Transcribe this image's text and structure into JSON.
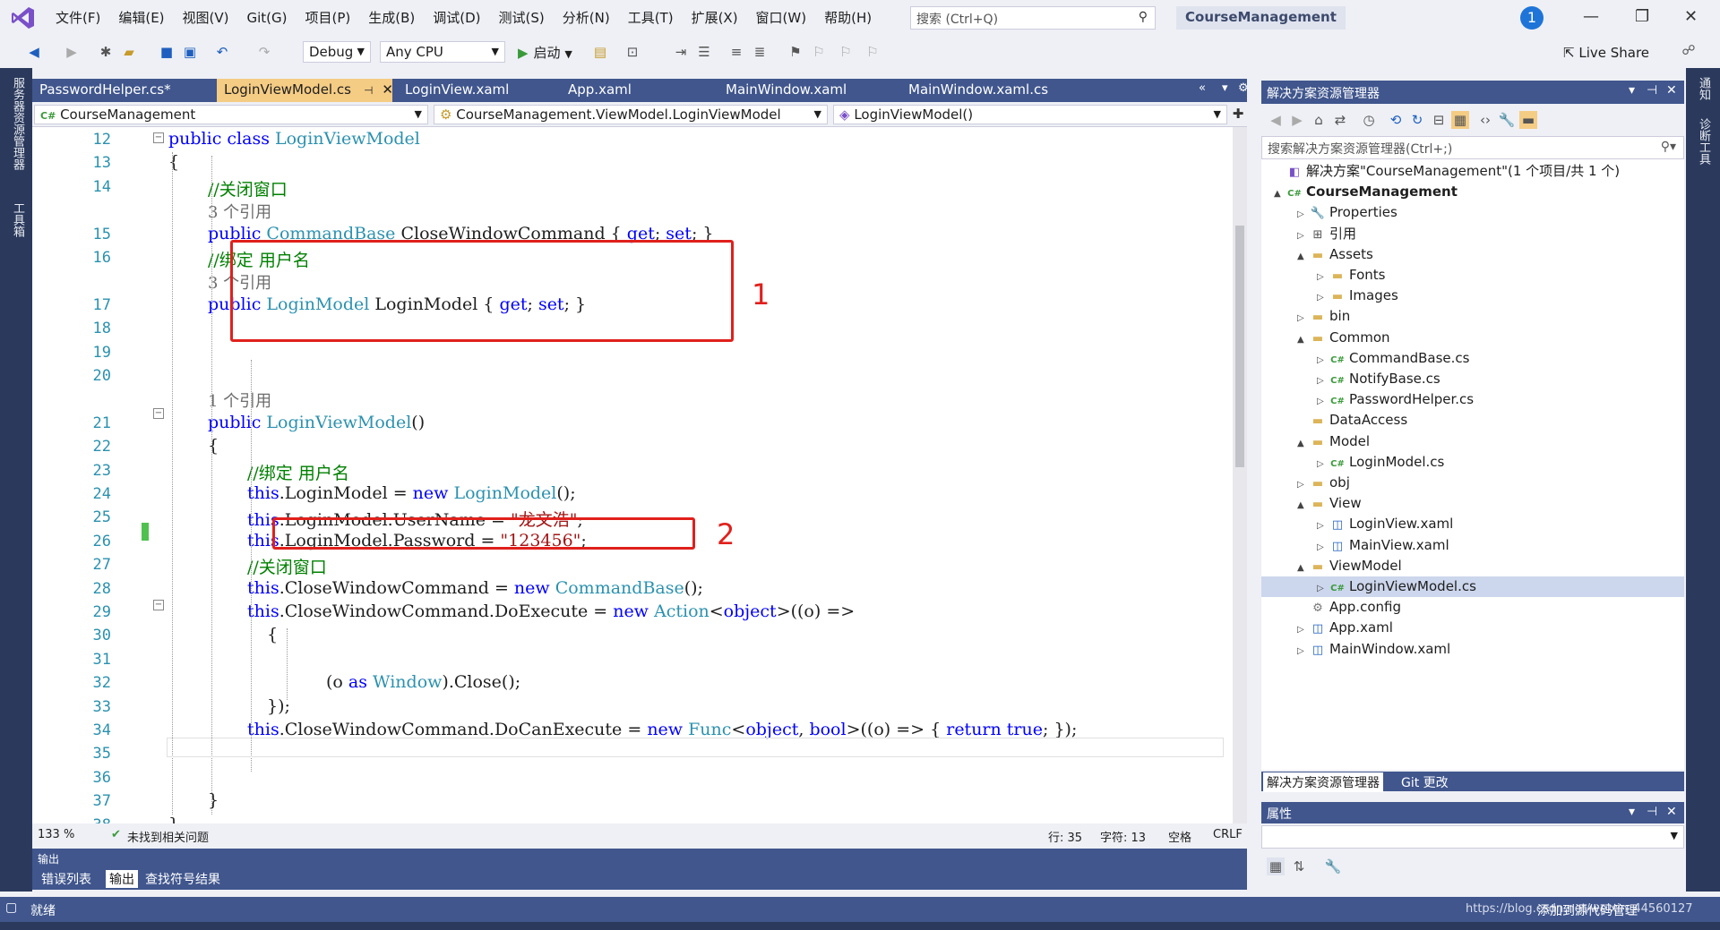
{
  "menu": [
    "文件(F)",
    "编辑(E)",
    "视图(V)",
    "Git(G)",
    "项目(P)",
    "生成(B)",
    "调试(D)",
    "测试(S)",
    "分析(N)",
    "工具(T)",
    "扩展(X)",
    "窗口(W)",
    "帮助(H)"
  ],
  "search": {
    "placeholder": "搜索 (Ctrl+Q)"
  },
  "solution_name": "CourseManagement",
  "notification_count": "1",
  "toolbar": {
    "config": "Debug",
    "platform": "Any CPU",
    "start": "启动",
    "live_share": "Live Share"
  },
  "tabs": [
    {
      "label": "PasswordHelper.cs*"
    },
    {
      "label": "LoginViewModel.cs"
    },
    {
      "label": "LoginView.xaml"
    },
    {
      "label": "App.xaml"
    },
    {
      "label": "MainWindow.xaml"
    },
    {
      "label": "MainWindow.xaml.cs"
    }
  ],
  "nav": {
    "project": "CourseManagement",
    "class": "CourseManagement.ViewModel.LoginViewModel",
    "member": "LoginViewModel()"
  },
  "left_strip": {
    "server": "服务器资源管理器",
    "toolbox": "工具箱"
  },
  "code": {
    "lines": [
      {
        "n": "12",
        "parts": [
          [
            "kw",
            "public class "
          ],
          [
            "ty",
            "LoginViewModel"
          ]
        ]
      },
      {
        "n": "13",
        "parts": [
          [
            "",
            "{"
          ]
        ]
      },
      {
        "n": "14",
        "parts": [
          [
            "cm",
            "//关闭窗口"
          ]
        ]
      },
      {
        "ref": "3 个引用"
      },
      {
        "n": "15",
        "parts": [
          [
            "kw",
            "public "
          ],
          [
            "ty",
            "CommandBase "
          ],
          [
            "",
            "CloseWindowCommand { "
          ],
          [
            "kw",
            "get"
          ],
          [
            "",
            "; "
          ],
          [
            "kw",
            "set"
          ],
          [
            "",
            "; }"
          ]
        ]
      },
      {
        "n": "16",
        "parts": [
          [
            "cm",
            "//绑定 用户名"
          ]
        ]
      },
      {
        "ref": "3 个引用"
      },
      {
        "n": "17",
        "parts": [
          [
            "kw",
            "public "
          ],
          [
            "ty",
            "LoginModel "
          ],
          [
            "",
            "LoginModel { "
          ],
          [
            "kw",
            "get"
          ],
          [
            "",
            "; "
          ],
          [
            "kw",
            "set"
          ],
          [
            "",
            "; }"
          ]
        ]
      },
      {
        "n": "18",
        "parts": []
      },
      {
        "n": "19",
        "parts": []
      },
      {
        "n": "20",
        "parts": []
      },
      {
        "ref": "1 个引用"
      },
      {
        "n": "21",
        "parts": [
          [
            "kw",
            "public "
          ],
          [
            "ty",
            "LoginViewModel"
          ],
          [
            "",
            "()"
          ]
        ]
      },
      {
        "n": "22",
        "parts": [
          [
            "",
            "{"
          ]
        ]
      },
      {
        "n": "23",
        "parts": [
          [
            "cm",
            "//绑定 用户名"
          ]
        ]
      },
      {
        "n": "24",
        "parts": [
          [
            "kw",
            "this"
          ],
          [
            "",
            ".LoginModel = "
          ],
          [
            "kw",
            "new "
          ],
          [
            "ty",
            "LoginModel"
          ],
          [
            "",
            "();"
          ]
        ]
      },
      {
        "n": "25",
        "parts": [
          [
            "kw",
            "this"
          ],
          [
            "",
            ".LoginModel.UserName = "
          ],
          [
            "st",
            "\"龙文浩\""
          ],
          [
            "",
            ";"
          ]
        ]
      },
      {
        "n": "26",
        "parts": [
          [
            "kw",
            "this"
          ],
          [
            "",
            ".LoginModel.Password = "
          ],
          [
            "st",
            "\"123456\""
          ],
          [
            "",
            ";"
          ]
        ]
      },
      {
        "n": "27",
        "parts": [
          [
            "cm",
            "//关闭窗口"
          ]
        ]
      },
      {
        "n": "28",
        "parts": [
          [
            "kw",
            "this"
          ],
          [
            "",
            ".CloseWindowCommand = "
          ],
          [
            "kw",
            "new "
          ],
          [
            "ty",
            "CommandBase"
          ],
          [
            "",
            "();"
          ]
        ]
      },
      {
        "n": "29",
        "parts": [
          [
            "kw",
            "this"
          ],
          [
            "",
            ".CloseWindowCommand.DoExecute = "
          ],
          [
            "kw",
            "new "
          ],
          [
            "ty",
            "Action"
          ],
          [
            "",
            "<"
          ],
          [
            "kw",
            "object"
          ],
          [
            "",
            ">((o) =>"
          ]
        ]
      },
      {
        "n": "30",
        "parts": [
          [
            "",
            "{"
          ]
        ]
      },
      {
        "n": "31",
        "parts": []
      },
      {
        "n": "32",
        "parts": [
          [
            "",
            "(o "
          ],
          [
            "kw",
            "as "
          ],
          [
            "ty",
            "Window"
          ],
          [
            "",
            ").Close();"
          ]
        ]
      },
      {
        "n": "33",
        "parts": [
          [
            "",
            "});"
          ]
        ]
      },
      {
        "n": "34",
        "parts": [
          [
            "kw",
            "this"
          ],
          [
            "",
            ".CloseWindowCommand.DoCanExecute = "
          ],
          [
            "kw",
            "new "
          ],
          [
            "ty",
            "Func"
          ],
          [
            "",
            "<"
          ],
          [
            "kw",
            "object"
          ],
          [
            "",
            ", "
          ],
          [
            "kw",
            "bool"
          ],
          [
            "",
            ">((o) => { "
          ],
          [
            "kw",
            "return true"
          ],
          [
            "",
            "; });"
          ]
        ]
      },
      {
        "n": "35",
        "parts": []
      },
      {
        "n": "36",
        "parts": []
      },
      {
        "n": "37",
        "parts": [
          [
            "",
            "}"
          ]
        ]
      },
      {
        "n": "38",
        "parts": [
          [
            "",
            "}"
          ]
        ]
      }
    ]
  },
  "annotations": {
    "box1": "1",
    "box2": "2"
  },
  "editor_status": {
    "zoom": "133 %",
    "issues": "未找到相关问题",
    "line": "行: 35",
    "col": "字符: 13",
    "space": "空格",
    "eol": "CRLF"
  },
  "output": {
    "title": "输出",
    "tabs": [
      "错误列表",
      "输出",
      "查找符号结果"
    ]
  },
  "solution_explorer": {
    "title": "解决方案资源管理器",
    "search": "搜索解决方案资源管理器(Ctrl+;)",
    "items": [
      {
        "label": "解决方案\"CourseManagement\"(1 个项目/共 1 个)",
        "icon": "solution-icon"
      },
      {
        "label": "CourseManagement",
        "icon": "csproj-icon"
      },
      {
        "label": "Properties",
        "icon": "wrench-icon"
      },
      {
        "label": "引用",
        "icon": "references-icon"
      },
      {
        "label": "Assets",
        "icon": "folder-icon"
      },
      {
        "label": "Fonts",
        "icon": "folder-icon"
      },
      {
        "label": "Images",
        "icon": "folder-icon"
      },
      {
        "label": "bin",
        "icon": "folder-icon"
      },
      {
        "label": "Common",
        "icon": "folder-icon"
      },
      {
        "label": "CommandBase.cs",
        "icon": "csharp-icon"
      },
      {
        "label": "NotifyBase.cs",
        "icon": "csharp-icon"
      },
      {
        "label": "PasswordHelper.cs",
        "icon": "csharp-icon"
      },
      {
        "label": "DataAccess",
        "icon": "folder-icon"
      },
      {
        "label": "Model",
        "icon": "folder-icon"
      },
      {
        "label": "LoginModel.cs",
        "icon": "csharp-icon"
      },
      {
        "label": "obj",
        "icon": "folder-icon"
      },
      {
        "label": "View",
        "icon": "folder-icon"
      },
      {
        "label": "LoginView.xaml",
        "icon": "xaml-icon"
      },
      {
        "label": "MainView.xaml",
        "icon": "xaml-icon"
      },
      {
        "label": "ViewModel",
        "icon": "folder-icon"
      },
      {
        "label": "LoginViewModel.cs",
        "icon": "csharp-icon"
      },
      {
        "label": "App.config",
        "icon": "config-icon"
      },
      {
        "label": "App.xaml",
        "icon": "xaml-icon"
      },
      {
        "label": "MainWindow.xaml",
        "icon": "xaml-icon"
      }
    ],
    "bottom_tabs": [
      "解决方案资源管理器",
      "Git 更改"
    ]
  },
  "properties": {
    "title": "属性"
  },
  "right_strip": {
    "notify": "通知",
    "diag": "诊断工具"
  },
  "status": {
    "ready": "就绪",
    "add_source": "添加到源代码管理",
    "watermark": "https://blog.csdn.net/weixin_44560127"
  }
}
